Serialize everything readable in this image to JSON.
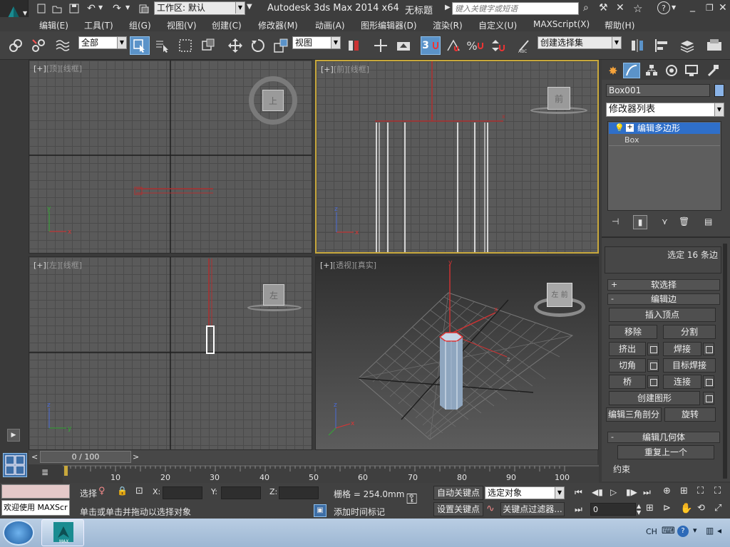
{
  "titlebar": {
    "workspace_label": "工作区: 默认",
    "app_title": "Autodesk 3ds Max  2014 x64",
    "document_title": "无标题",
    "search_placeholder": "键入关键字或短语"
  },
  "menu": [
    "编辑(E)",
    "工具(T)",
    "组(G)",
    "视图(V)",
    "创建(C)",
    "修改器(M)",
    "动画(A)",
    "图形编辑器(D)",
    "渲染(R)",
    "自定义(U)",
    "MAXScript(X)",
    "帮助(H)"
  ],
  "toolbar": {
    "selection_filter": "全部",
    "ref_coord": "视图",
    "named_selection": "创建选择集",
    "snap_number": "3"
  },
  "viewports": {
    "top": {
      "plus": "[+]",
      "name": "[顶]",
      "mode": "[线框]",
      "cube": "上"
    },
    "front": {
      "plus": "[+]",
      "name": "[前]",
      "mode": "[线框]",
      "cube": "前"
    },
    "left": {
      "plus": "[+]",
      "name": "[左]",
      "mode": "[线框]",
      "cube": "左"
    },
    "persp": {
      "plus": "[+]",
      "name": "[透视]",
      "mode": "[真实]",
      "cube": "左 前"
    },
    "axis": {
      "x": "x",
      "y": "y",
      "z": "z"
    }
  },
  "command_panel": {
    "object_name": "Box001",
    "object_color": "#8ab4e8",
    "modifier_list": "修改器列表",
    "stack": [
      {
        "label": "编辑多边形",
        "selected": true
      },
      {
        "label": "Box",
        "selected": false
      }
    ],
    "selection_info": "选定 16 条边",
    "rollout_soft": "软选择",
    "rollout_edit_edges": "编辑边",
    "buttons": {
      "insert_vertex": "插入顶点",
      "remove": "移除",
      "split": "分割",
      "extrude": "挤出",
      "weld": "焊接",
      "chamfer": "切角",
      "target_weld": "目标焊接",
      "bridge": "桥",
      "connect": "连接",
      "create_shape": "创建图形",
      "edit_tri": "编辑三角剖分",
      "turn": "旋转"
    },
    "rollout_edit_geom": "编辑几何体",
    "repeat_last": "重复上一个",
    "constraints": "约束"
  },
  "timeline": {
    "frame_display": "0 / 100",
    "ticks": [
      "10",
      "20",
      "30",
      "40",
      "50",
      "60",
      "70",
      "80",
      "90",
      "100"
    ]
  },
  "status": {
    "welcome": "欢迎使用 MAXScr",
    "selection_label": "选择",
    "x_label": "X:",
    "y_label": "Y:",
    "z_label": "Z:",
    "grid": "栅格 = 254.0mm",
    "auto_key": "自动关键点",
    "key_mode": "选定对象",
    "set_key": "设置关键点",
    "key_filter": "关键点过滤器...",
    "prompt": "单击或单击并拖动以选择对象",
    "add_time_tag": "添加时间标记",
    "current_frame": "0"
  },
  "taskbar": {
    "app_label": "MAX",
    "lang": "CH"
  }
}
